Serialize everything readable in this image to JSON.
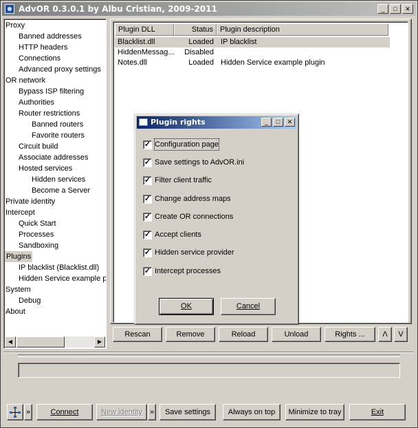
{
  "window": {
    "title": "AdvOR  0.3.0.1 by Albu Cristian, 2009-2011"
  },
  "caption_buttons": {
    "minimize": "_",
    "maximize": "□",
    "close": "✕"
  },
  "tree": {
    "items": [
      {
        "label": "Proxy",
        "level": 0
      },
      {
        "label": "Banned addresses",
        "level": 1
      },
      {
        "label": "HTTP headers",
        "level": 1
      },
      {
        "label": "Connections",
        "level": 1
      },
      {
        "label": "Advanced proxy settings",
        "level": 1
      },
      {
        "label": "OR network",
        "level": 0
      },
      {
        "label": "Bypass ISP filtering",
        "level": 1
      },
      {
        "label": "Authorities",
        "level": 1
      },
      {
        "label": "Router restrictions",
        "level": 1
      },
      {
        "label": "Banned routers",
        "level": 2
      },
      {
        "label": "Favorite routers",
        "level": 2
      },
      {
        "label": "Circuit build",
        "level": 1
      },
      {
        "label": "Associate addresses",
        "level": 1
      },
      {
        "label": "Hosted services",
        "level": 1
      },
      {
        "label": "Hidden services",
        "level": 2
      },
      {
        "label": "Become a Server",
        "level": 2
      },
      {
        "label": "Private identity",
        "level": 0
      },
      {
        "label": "Intercept",
        "level": 0
      },
      {
        "label": "Quick Start",
        "level": 1
      },
      {
        "label": "Processes",
        "level": 1
      },
      {
        "label": "Sandboxing",
        "level": 1
      },
      {
        "label": "Plugins",
        "level": 0,
        "selected": true
      },
      {
        "label": "IP blacklist (Blacklist.dll)",
        "level": 1
      },
      {
        "label": "Hidden Service example p",
        "level": 1
      },
      {
        "label": "System",
        "level": 0
      },
      {
        "label": "Debug",
        "level": 1
      },
      {
        "label": "About",
        "level": 0
      }
    ],
    "scroll_left": "◀",
    "scroll_right": "▶"
  },
  "plugins": {
    "columns": [
      "Plugin DLL",
      "Status",
      "Plugin description"
    ],
    "rows": [
      {
        "dll": "Blacklist.dll",
        "status": "Loaded",
        "description": "IP blacklist",
        "selected": true
      },
      {
        "dll": "HiddenMessag...",
        "status": "Disabled",
        "description": ""
      },
      {
        "dll": "Notes.dll",
        "status": "Loaded",
        "description": "Hidden Service example plugin"
      }
    ]
  },
  "plugin_buttons": {
    "rescan": "Rescan",
    "remove": "Remove",
    "reload": "Reload",
    "unload": "Unload",
    "rights": "Rights ...",
    "up": "Λ",
    "down": "V"
  },
  "dialog": {
    "title": "Plugin rights",
    "checkboxes": [
      {
        "label": "Configuration page",
        "checked": true
      },
      {
        "label": "Save settings to AdvOR.ini",
        "checked": true
      },
      {
        "label": "Filter client traffic",
        "checked": true
      },
      {
        "label": "Change address maps",
        "checked": true
      },
      {
        "label": "Create OR connections",
        "checked": true
      },
      {
        "label": "Accept clients",
        "checked": true
      },
      {
        "label": "Hidden service provider",
        "checked": true
      },
      {
        "label": "Intercept processes",
        "checked": true
      }
    ],
    "ok": "OK",
    "cancel": "Cancel",
    "check_glyph": "✓"
  },
  "bottom_bar": {
    "identity_icon": "network-icon",
    "more1": "»",
    "connect": "Connect",
    "new_identity": "New identity",
    "more2": "»",
    "save_settings": "Save settings",
    "always_on_top": "Always on top",
    "minimize_to_tray": "Minimize to tray",
    "exit": "Exit"
  },
  "status_text": ""
}
